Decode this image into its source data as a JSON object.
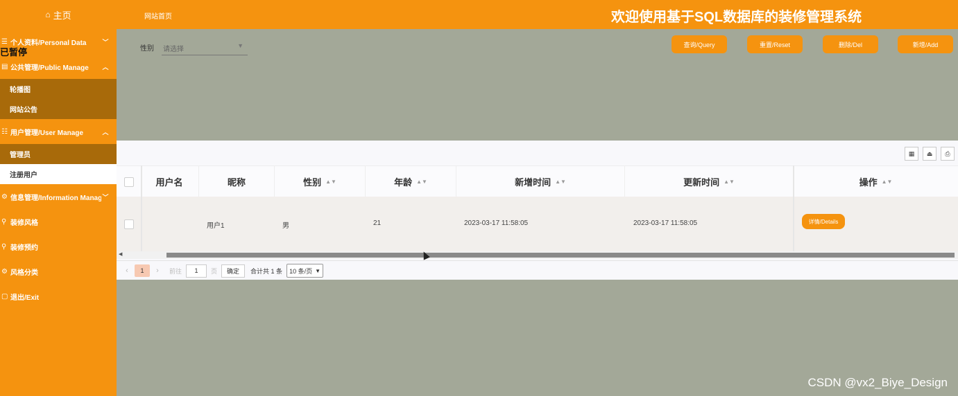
{
  "sidebar": {
    "home": "主页",
    "overlay": "已暂停",
    "menus": {
      "personal": "个人资料/Personal Data",
      "public": "公共管理/Public Manage",
      "public_items": [
        "轮播图",
        "网站公告"
      ],
      "user": "用户管理/User Manage",
      "user_items": [
        "管理员",
        "注册用户"
      ],
      "info": "信息管理/Information Manage",
      "style": "装修风格",
      "booking": "装修预约",
      "category": "风格分类",
      "exit": "退出/Exit"
    }
  },
  "header": {
    "breadcrumb": "网站首页",
    "title": "欢迎使用基于SQL数据库的装修管理系统"
  },
  "search": {
    "label": "性别",
    "placeholder": "请选择",
    "buttons": {
      "query": "查询/Query",
      "reset": "重置/Reset",
      "delete": "删除/Del",
      "add": "新增/Add"
    }
  },
  "table": {
    "columns": [
      "用户名",
      "昵称",
      "性别",
      "年龄",
      "新增时间",
      "更新时间",
      "操作"
    ],
    "rows": [
      {
        "username": "",
        "nickname": "用户1",
        "gender": "男",
        "age": "21",
        "created": "2023-03-17 11:58:05",
        "updated": "2023-03-17 11:58:05",
        "action": "详情/Details"
      }
    ]
  },
  "pager": {
    "current": "1",
    "goto": "前往",
    "input": "1",
    "unit": "页",
    "ok": "确定",
    "total": "合计共 1 条",
    "page_size": "10 条/页"
  },
  "watermark": "CSDN @vx2_Biye_Design",
  "colors": {
    "accent": "#f5930f",
    "dark_sub": "#a86a0a",
    "content_bg": "#a3a898"
  }
}
